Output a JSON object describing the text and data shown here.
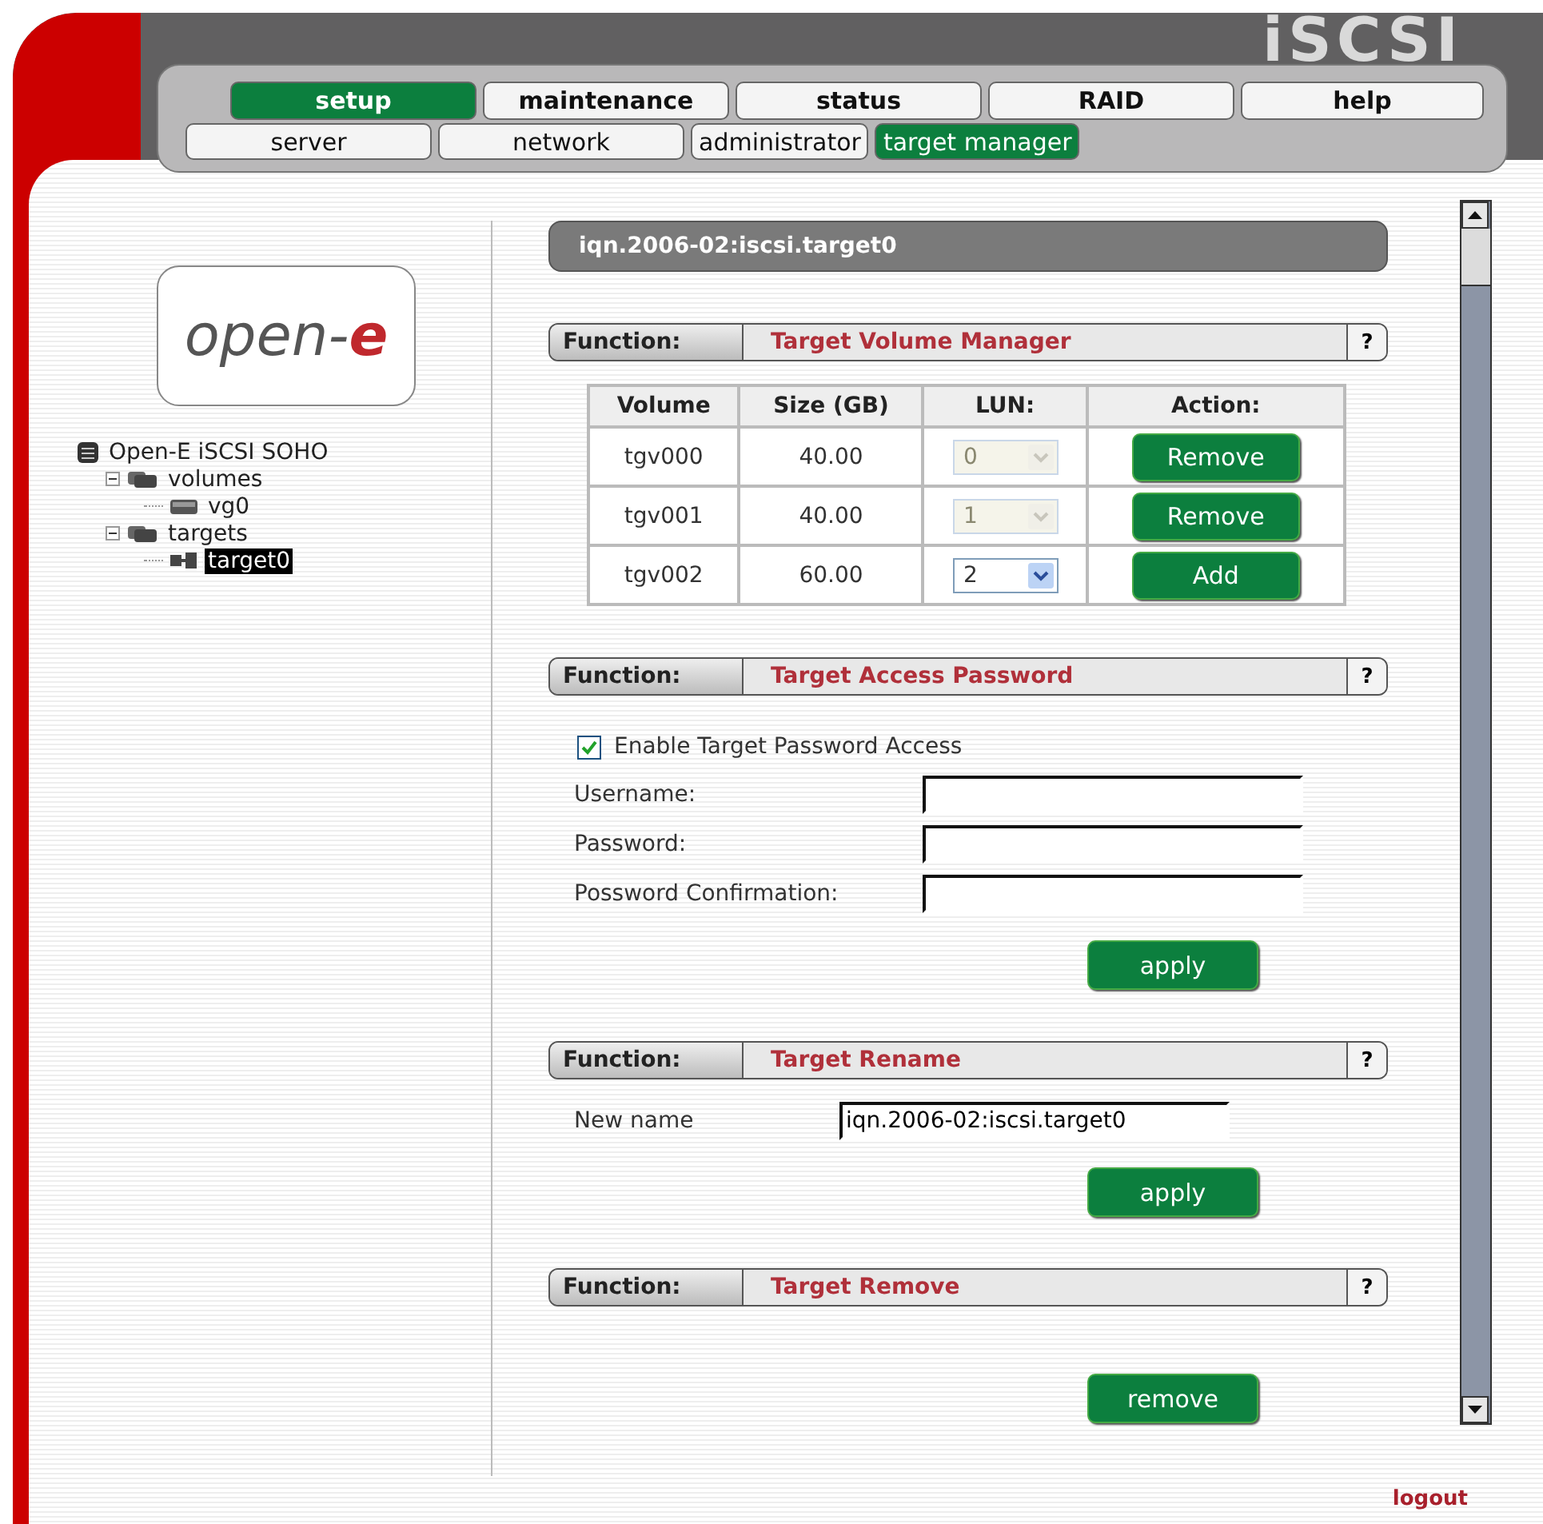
{
  "logo": "iSCSI",
  "main_tabs": [
    {
      "label": "setup",
      "selected": true
    },
    {
      "label": "maintenance",
      "selected": false
    },
    {
      "label": "status",
      "selected": false
    },
    {
      "label": "RAID",
      "selected": false
    },
    {
      "label": "help",
      "selected": false
    }
  ],
  "sub_tabs": [
    {
      "label": "server",
      "selected": false
    },
    {
      "label": "network",
      "selected": false
    },
    {
      "label": "administrator",
      "selected": false
    },
    {
      "label": "target manager",
      "selected": true
    }
  ],
  "sidebar": {
    "brand": {
      "text": "open-",
      "accent": "e"
    },
    "tree": [
      {
        "label": "Open-E iSCSI SOHO",
        "kind": "server",
        "selected": false,
        "children": [
          {
            "label": "volumes",
            "kind": "folder",
            "expanded": true,
            "selected": false,
            "children": [
              {
                "label": "vg0",
                "kind": "volume",
                "selected": false
              }
            ]
          },
          {
            "label": "targets",
            "kind": "folder",
            "expanded": true,
            "selected": false,
            "children": [
              {
                "label": "target0",
                "kind": "target",
                "selected": true
              }
            ]
          }
        ]
      }
    ]
  },
  "page_title": "iqn.2006-02:iscsi.target0",
  "sections": [
    {
      "kind": "volumes",
      "function_label": "Function:",
      "title": "Target Volume Manager",
      "help": "?",
      "table": {
        "columns": [
          "Volume",
          "Size (GB)",
          "LUN:",
          "Action:"
        ],
        "rows": [
          {
            "volume": "tgv000",
            "size": "40.00",
            "lun": "0",
            "disabled": true,
            "action": "Remove"
          },
          {
            "volume": "tgv001",
            "size": "40.00",
            "lun": "1",
            "disabled": true,
            "action": "Remove"
          },
          {
            "volume": "tgv002",
            "size": "60.00",
            "lun": "2",
            "disabled": false,
            "action": "Add"
          }
        ]
      }
    },
    {
      "kind": "password",
      "function_label": "Function:",
      "title": "Target Access Password",
      "help": "?",
      "checkbox": {
        "label": "Enable Target Password Access",
        "checked": true
      },
      "fields": [
        {
          "label": "Username:"
        },
        {
          "label": "Password:"
        },
        {
          "label": "Possword Confirmation:"
        }
      ],
      "button": "apply"
    },
    {
      "kind": "rename",
      "function_label": "Function:",
      "title": "Target Rename",
      "help": "?",
      "field": {
        "label": "New name",
        "value": "iqn.2006-02:iscsi.target0"
      },
      "button": "apply"
    },
    {
      "kind": "remove",
      "function_label": "Function:",
      "title": "Target Remove",
      "help": "?",
      "button": "remove"
    }
  ],
  "logout": "logout"
}
